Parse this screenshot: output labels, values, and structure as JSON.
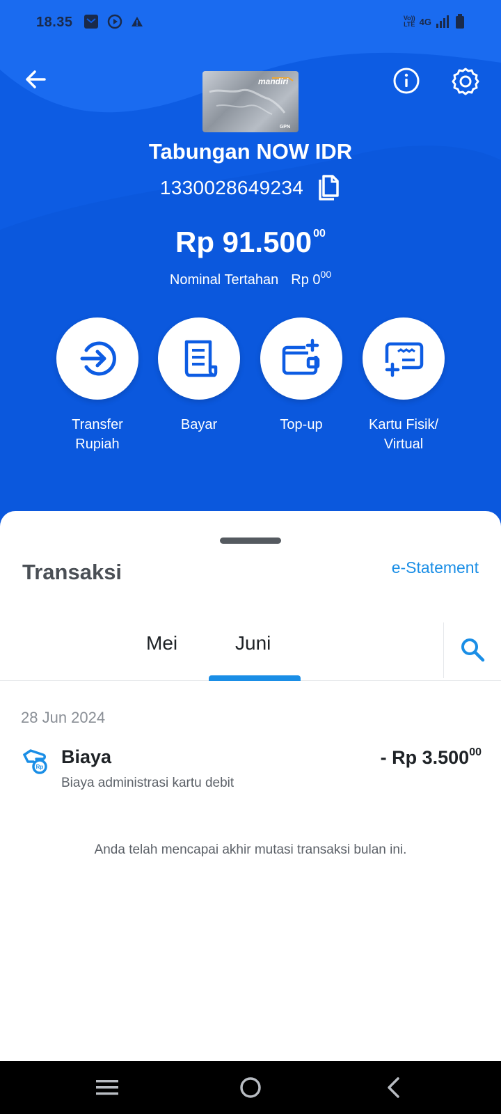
{
  "status_bar": {
    "time": "18.35",
    "network": "4G",
    "volte_top": "Vo))",
    "volte_bottom": "LTE"
  },
  "account": {
    "card_brand": "mandiri",
    "card_network": "GPN",
    "name": "Tabungan NOW IDR",
    "number": "1330028649234",
    "balance_main": "Rp 91.500",
    "balance_cents": "00",
    "hold_label": "Nominal Tertahan",
    "hold_amount": "Rp 0",
    "hold_cents": "00"
  },
  "actions": [
    {
      "label_line1": "Transfer",
      "label_line2": "Rupiah",
      "icon": "transfer-icon"
    },
    {
      "label_line1": "Bayar",
      "label_line2": "",
      "icon": "bill-icon"
    },
    {
      "label_line1": "Top-up",
      "label_line2": "",
      "icon": "wallet-plus-icon"
    },
    {
      "label_line1": "Kartu Fisik/",
      "label_line2": "Virtual",
      "icon": "card-plus-icon"
    }
  ],
  "transactions": {
    "title": "Transaksi",
    "estatement_label": "e-Statement",
    "tabs": [
      "Mei",
      "Juni"
    ],
    "active_tab": "Juni",
    "groups": [
      {
        "date": "28 Jun 2024",
        "items": [
          {
            "title": "Biaya",
            "subtitle": "Biaya administrasi kartu debit",
            "amount": "- Rp 3.500",
            "amount_cents": "00",
            "icon": "fee-icon"
          }
        ]
      }
    ],
    "end_note": "Anda telah mencapai akhir mutasi transaksi bulan ini."
  },
  "colors": {
    "primary_blue": "#0d5ce3",
    "accent_blue": "#1a8ee6",
    "text_dark": "#1e2226"
  }
}
